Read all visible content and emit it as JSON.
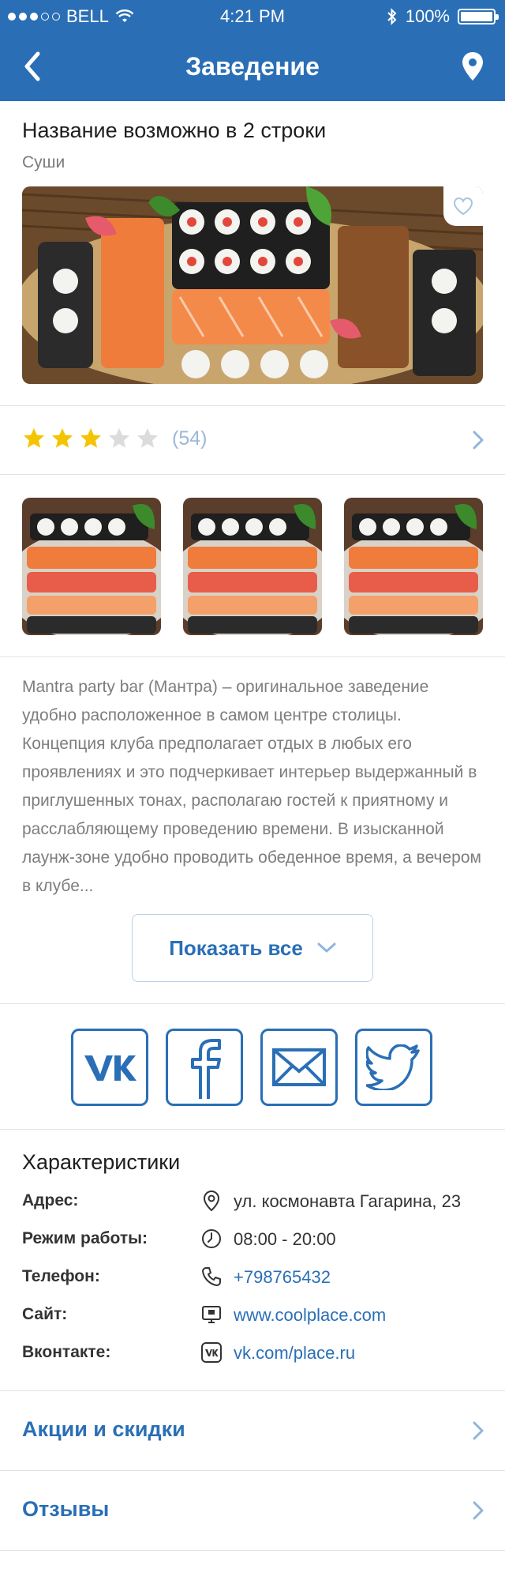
{
  "status_bar": {
    "carrier": "BELL",
    "time": "4:21 PM",
    "battery": "100%"
  },
  "nav": {
    "title": "Заведение"
  },
  "venue": {
    "title": "Название возможно в 2 строки",
    "category": "Суши"
  },
  "rating": {
    "stars": 3,
    "max_stars": 5,
    "count": "(54)"
  },
  "description": {
    "text": "Mantra party bar (Мантра) – оригинальное заведение удобно расположенное в самом центре столицы. Концепция клуба предполагает отдых в любых его проявлениях и это подчеркивает интерьер выдержанный в приглушенных тонах, располагаю гостей к приятному и расслабляющему проведению времени. В изысканной лаунж-зоне удобно проводить обеденное время, а вечером в клубе..."
  },
  "show_all": {
    "label": "Показать все"
  },
  "social": {
    "icons": [
      "vk-icon",
      "facebook-icon",
      "email-icon",
      "twitter-icon"
    ]
  },
  "characteristics": {
    "title": "Характеристики",
    "rows": [
      {
        "label": "Адрес:",
        "value": "ул. космонавта Гагарина, 23",
        "icon": "location-pin-icon"
      },
      {
        "label": "Режим работы:",
        "value": "08:00 - 20:00",
        "icon": "clock-icon"
      },
      {
        "label": "Телефон:",
        "value": "+798765432",
        "icon": "phone-icon"
      },
      {
        "label": "Сайт:",
        "value": "www.coolplace.com",
        "icon": "monitor-icon"
      },
      {
        "label": "Вконтакте:",
        "value": "vk.com/place.ru",
        "icon": "vk-icon"
      }
    ]
  },
  "sections": {
    "promo": "Акции и скидки",
    "reviews": "Отзывы"
  },
  "colors": {
    "brand": "#2a6fb6",
    "star_active": "#f5c400",
    "star_inactive": "#dcdcdc",
    "muted_text": "#7d7d7d"
  }
}
